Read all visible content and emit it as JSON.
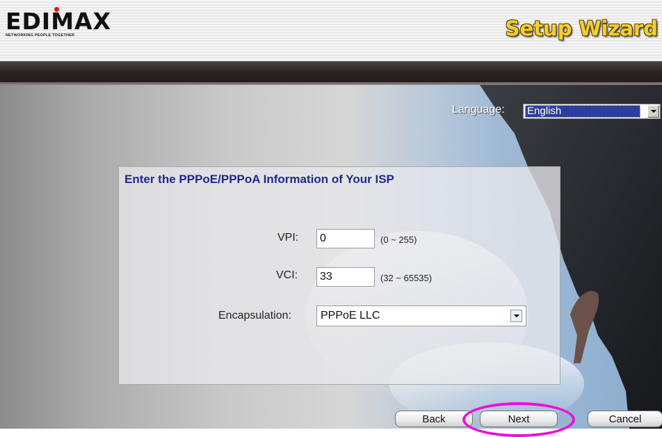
{
  "header": {
    "brand": "EDIMAX",
    "tagline": "NETWORKING PEOPLE TOGETHER",
    "title": "Setup Wizard",
    "title_color": "#f2cf32"
  },
  "language": {
    "label": "Language:",
    "selected": "English"
  },
  "form": {
    "title": "Enter the PPPoE/PPPoA Information of Your ISP",
    "vpi": {
      "label": "VPI:",
      "value": "0",
      "range": "(0 ~ 255)"
    },
    "vci": {
      "label": "VCI:",
      "value": "33",
      "range": "(32 ~ 65535)"
    },
    "encapsulation": {
      "label": "Encapsulation:",
      "selected": "PPPoE LLC"
    }
  },
  "buttons": {
    "back": "Back",
    "next": "Next",
    "cancel": "Cancel",
    "highlight_color": "#ec0fd8"
  },
  "icons": [
    "chevron-down-icon",
    "chevron-down-icon"
  ]
}
